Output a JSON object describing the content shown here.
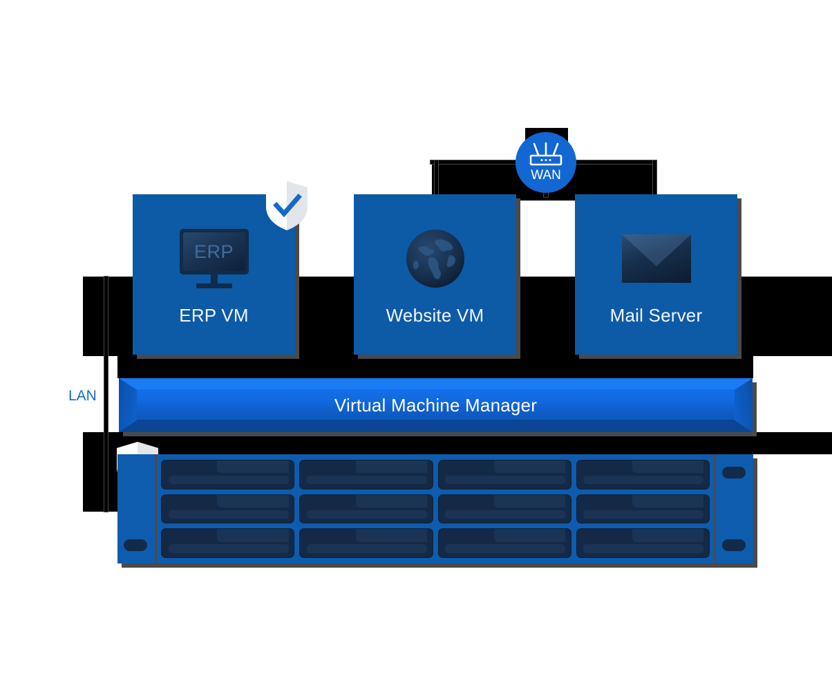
{
  "diagram": {
    "title": "Virtual Machine Manager infrastructure diagram",
    "network_labels": {
      "wan": "WAN",
      "lan": "LAN"
    },
    "vms": [
      {
        "label": "ERP VM",
        "icon": "monitor-icon",
        "screen_text": "ERP",
        "has_shield_badge": true
      },
      {
        "label": "Website VM",
        "icon": "globe-icon",
        "screen_text": "",
        "has_shield_badge": false
      },
      {
        "label": "Mail Server",
        "icon": "envelope-icon",
        "screen_text": "",
        "has_shield_badge": false
      }
    ],
    "manager": {
      "label": "Virtual Machine Manager"
    },
    "storage": {
      "name": "server-rack",
      "bay_rows": 3,
      "bay_columns": 4,
      "has_shield_badge": true
    },
    "colors": {
      "vm_card": "#0d5aa7",
      "manager_bar": "#1169e0",
      "rack_chassis": "#0e5cae",
      "bay": "#142945",
      "wan_node": "#1267d2",
      "lan_text": "#1569c7",
      "shadow": "#4a4a4a",
      "shield": "#ffffff",
      "check": "#1569c7"
    }
  }
}
